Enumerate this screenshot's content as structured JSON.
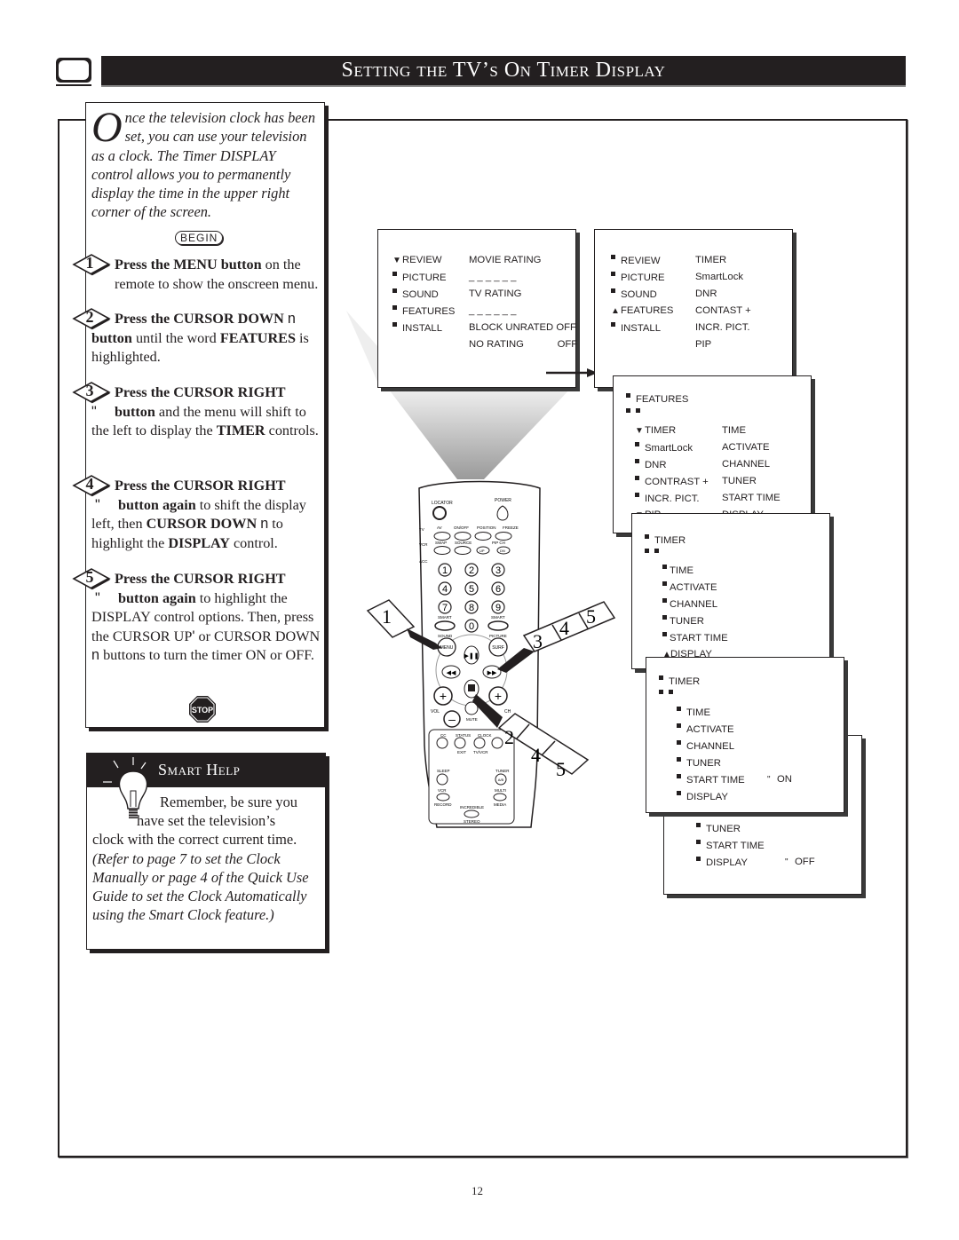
{
  "header": {
    "title": "Setting the TV’s On Timer Display",
    "icon": "tv-icon"
  },
  "intro": {
    "dropcap": "O",
    "text": "nce the television clock has been set, you can use your television as a clock. The Timer DISPLAY control allows you to permanently display the time in the upper right corner of the screen.",
    "begin_label": "BEGIN"
  },
  "steps": [
    {
      "number": "1",
      "bold": "Press the MENU button",
      "rest": " on the remote to show the onscreen menu."
    },
    {
      "number": "2",
      "bold": "Press the CURSOR DOWN",
      "glyph": "n",
      "bold2": "button",
      "rest": " until the word ",
      "bold3": "FEATURES",
      "rest2": " is highlighted."
    },
    {
      "number": "3",
      "bold": "Press the CURSOR RIGHT",
      "glyph": "\"",
      "bold2": "button",
      "rest": " and the menu will shift to the left to display the ",
      "bold3": "TIMER",
      "rest2": " controls."
    },
    {
      "number": "4",
      "bold": "Press the CURSOR RIGHT",
      "glyph": "\"",
      "bold2": "button again",
      "rest": " to shift the display left, then ",
      "bold3": "CURSOR DOWN",
      "glyph2": "n",
      "rest2": " to highlight the ",
      "bold4": "DISPLAY",
      "rest3": " control."
    },
    {
      "number": "5",
      "bold": "Press the CURSOR RIGHT",
      "glyph": "\"",
      "bold2": "button again",
      "rest": " to highlight the DISPLAY control options. Then, press the CURSOR UP",
      "glyph2": "'",
      "rest2": " or CURSOR DOWN",
      "glyph3": "n",
      "rest3": " buttons to turn the timer ON or OFF."
    }
  ],
  "stop_label": "STOP",
  "smart_help": {
    "title": "Smart Help",
    "line1": "Remember, be sure you",
    "line2": "have set the television’s",
    "line3": "clock with the correct current time.",
    "italic": "(Refer to page 7 to set the Clock Manually or page 4 of the Quick Use Guide to set the Clock Automatically using the Smart Clock feature.)"
  },
  "screens": {
    "main_menu": {
      "left": [
        "REVIEW",
        "PICTURE",
        "SOUND",
        "FEATURES",
        "INSTALL"
      ],
      "right": [
        "MOVIE RATING",
        "_ _ _ _ _ _",
        "TV RATING",
        "_ _ _ _ _ _",
        "BLOCK UNRATED  OFF",
        "NO RATING            OFF"
      ]
    },
    "features_menu": {
      "left": [
        "REVIEW",
        "PICTURE",
        "SOUND",
        "FEATURES",
        "INSTALL"
      ],
      "right": [
        "TIMER",
        "SmartLock",
        "DNR",
        "CONTAST +",
        "INCR. PICT.",
        "PIP"
      ]
    },
    "timer_menu": {
      "header": "FEATURES",
      "left": [
        "TIMER",
        "SmartLock",
        "DNR",
        "CONTRAST +",
        "INCR. PICT.",
        "PIP"
      ],
      "right": [
        "TIME",
        "ACTIVATE",
        "CHANNEL",
        "TUNER",
        "START TIME",
        "DISPLAY"
      ]
    },
    "timer_display_menu": {
      "header": "TIMER",
      "items": [
        "TIME",
        "ACTIVATE",
        "CHANNEL",
        "TUNER",
        "START TIME",
        "DISPLAY"
      ]
    },
    "display_on_menu": {
      "header": "TIMER",
      "items": [
        "TIME",
        "ACTIVATE",
        "CHANNEL",
        "TUNER",
        "START TIME",
        "DISPLAY"
      ],
      "value": "ON"
    },
    "display_off_menu": {
      "items": [
        "TUNER",
        "START TIME",
        "DISPLAY"
      ],
      "value": "OFF"
    }
  },
  "remote": {
    "labels": {
      "locator": "LOCATOR",
      "power": "POWER",
      "tv": "TV",
      "vcr": "VCR",
      "acc": "ACC",
      "av": "AV",
      "onoff": "ON/OFF",
      "position": "POSITION",
      "freeze": "FREEZE",
      "swap": "SWAP",
      "source": "SOURCE",
      "pipch": "PIP CH",
      "up": "UP",
      "dn": "DN",
      "smart1": "SMART",
      "smart2": "SMART",
      "sound": "SOUND",
      "picture": "PICTURE",
      "menu": "MENU",
      "surf": "SURF",
      "vol": "VOL",
      "ch": "CH",
      "mute": "MUTE",
      "cc": "CC",
      "status": "STATUS",
      "clock": "CLOCK",
      "exit": "EXIT",
      "tvvcr": "TV/VCR",
      "sleep": "SLEEP",
      "tuner": "TUNER",
      "ab": "A/B",
      "vcr2": "VCR",
      "record": "RECORD",
      "multi": "MULTI",
      "media": "MEDIA",
      "incredible": "INCREDIBLE",
      "stereo": "STEREO"
    },
    "digits": [
      "1",
      "2",
      "3",
      "4",
      "5",
      "6",
      "7",
      "8",
      "9",
      "0"
    ],
    "callouts": {
      "left": "1",
      "right": [
        "3",
        "4",
        "5"
      ],
      "down": [
        "2",
        "4",
        "5"
      ]
    }
  },
  "page_number": "12"
}
